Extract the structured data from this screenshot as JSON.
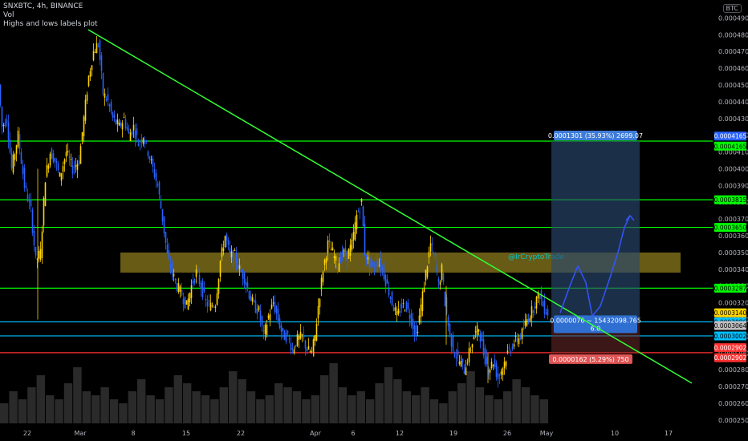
{
  "header": {
    "symbol_line": "SNXBTC, 4h, BINANCE",
    "indicator_1": "Vol",
    "indicator_2": "Highs and lows labels plot",
    "currency": "BTC"
  },
  "chart_data": {
    "type": "candlestick",
    "x_ticks": [
      "22",
      "Mar",
      "8",
      "15",
      "22",
      "Apr",
      "6",
      "12",
      "19",
      "26",
      "May",
      "10",
      "17"
    ],
    "y_ticks": [
      "0.0004900",
      "0.0004800",
      "0.0004700",
      "0.0004600",
      "0.0004500",
      "0.0004400",
      "0.0004300",
      "0.0004200",
      "0.0004100",
      "0.0004000",
      "0.0003900",
      "0.0003800",
      "0.0003700",
      "0.0003600",
      "0.0003500",
      "0.0003400",
      "0.0003300",
      "0.0003200",
      "0.0003100",
      "0.0003000",
      "0.0002900",
      "0.0002800",
      "0.0002700",
      "0.0002600",
      "0.0002500"
    ],
    "ylim": [
      0.000248,
      0.000495
    ],
    "price_path": [
      [
        0,
        0.00045
      ],
      [
        4,
        0.000425
      ],
      [
        10,
        0.00043
      ],
      [
        16,
        0.0004
      ],
      [
        24,
        0.00042
      ],
      [
        32,
        0.00039
      ],
      [
        40,
        0.000375
      ],
      [
        46,
        0.000345
      ],
      [
        52,
        0.00035
      ],
      [
        58,
        0.000395
      ],
      [
        64,
        0.00041
      ],
      [
        70,
        0.000405
      ],
      [
        76,
        0.000395
      ],
      [
        84,
        0.00041
      ],
      [
        92,
        0.0004
      ],
      [
        100,
        0.000405
      ],
      [
        106,
        0.00043
      ],
      [
        112,
        0.000455
      ],
      [
        118,
        0.00047
      ],
      [
        124,
        0.000475
      ],
      [
        130,
        0.000445
      ],
      [
        136,
        0.00044
      ],
      [
        142,
        0.00043
      ],
      [
        150,
        0.000425
      ],
      [
        156,
        0.00043
      ],
      [
        162,
        0.00042
      ],
      [
        168,
        0.000425
      ],
      [
        174,
        0.000415
      ],
      [
        180,
        0.00042
      ],
      [
        186,
        0.00041
      ],
      [
        192,
        0.0004
      ],
      [
        198,
        0.00039
      ],
      [
        204,
        0.00037
      ],
      [
        210,
        0.000348
      ],
      [
        216,
        0.000338
      ],
      [
        222,
        0.00033
      ],
      [
        228,
        0.000325
      ],
      [
        234,
        0.000318
      ],
      [
        240,
        0.00033
      ],
      [
        246,
        0.000338
      ],
      [
        252,
        0.00033
      ],
      [
        258,
        0.00032
      ],
      [
        264,
        0.000318
      ],
      [
        270,
        0.00032
      ],
      [
        276,
        0.000345
      ],
      [
        282,
        0.00036
      ],
      [
        288,
        0.000348
      ],
      [
        294,
        0.000348
      ],
      [
        300,
        0.00034
      ],
      [
        306,
        0.000335
      ],
      [
        312,
        0.000325
      ],
      [
        318,
        0.000318
      ],
      [
        324,
        0.000315
      ],
      [
        330,
        0.0003
      ],
      [
        336,
        0.000312
      ],
      [
        342,
        0.00032
      ],
      [
        348,
        0.00031
      ],
      [
        354,
        0.0003
      ],
      [
        360,
        0.0003
      ],
      [
        366,
        0.000292
      ],
      [
        372,
        0.000298
      ],
      [
        378,
        0.0003
      ],
      [
        384,
        0.000292
      ],
      [
        390,
        0.00029
      ],
      [
        394,
        0.0003
      ],
      [
        398,
        0.000318
      ],
      [
        404,
        0.00034
      ],
      [
        410,
        0.000355
      ],
      [
        416,
        0.00035
      ],
      [
        422,
        0.000342
      ],
      [
        428,
        0.00035
      ],
      [
        434,
        0.000348
      ],
      [
        440,
        0.000355
      ],
      [
        446,
        0.000372
      ],
      [
        452,
        0.00038
      ],
      [
        456,
        0.00035
      ],
      [
        460,
        0.000345
      ],
      [
        466,
        0.00034
      ],
      [
        472,
        0.000345
      ],
      [
        478,
        0.00034
      ],
      [
        484,
        0.00033
      ],
      [
        490,
        0.00032
      ],
      [
        496,
        0.000312
      ],
      [
        502,
        0.000318
      ],
      [
        508,
        0.000318
      ],
      [
        514,
        0.00031
      ],
      [
        520,
        0.0003
      ],
      [
        526,
        0.000318
      ],
      [
        532,
        0.000338
      ],
      [
        538,
        0.000355
      ],
      [
        544,
        0.000345
      ],
      [
        548,
        0.00033
      ],
      [
        552,
        0.00034
      ],
      [
        556,
        0.00032
      ],
      [
        562,
        0.0003
      ],
      [
        568,
        0.00029
      ],
      [
        574,
        0.000285
      ],
      [
        580,
        0.00028
      ],
      [
        586,
        0.00029
      ],
      [
        592,
        0.0003
      ],
      [
        598,
        0.000305
      ],
      [
        604,
        0.00029
      ],
      [
        610,
        0.00028
      ],
      [
        616,
        0.000285
      ],
      [
        622,
        0.000275
      ],
      [
        628,
        0.000282
      ],
      [
        634,
        0.00029
      ],
      [
        640,
        0.000295
      ],
      [
        646,
        0.000298
      ],
      [
        652,
        0.000302
      ],
      [
        658,
        0.00031
      ],
      [
        664,
        0.000315
      ],
      [
        670,
        0.000322
      ],
      [
        674,
        0.000325
      ],
      [
        678,
        0.000318
      ],
      [
        684,
        0.000314
      ]
    ],
    "volume_bars": [
      5,
      8,
      6,
      9,
      12,
      7,
      6,
      10,
      14,
      8,
      7,
      9,
      6,
      5,
      8,
      11,
      7,
      6,
      9,
      12,
      10,
      8,
      7,
      6,
      9,
      13,
      11,
      8,
      6,
      7,
      10,
      9,
      8,
      6,
      7,
      12,
      15,
      9,
      7,
      8,
      6,
      10,
      14,
      11,
      8,
      7,
      9,
      6,
      5,
      8,
      10,
      13,
      9,
      7,
      6,
      8,
      11,
      9,
      7,
      6
    ],
    "horizontal_levels": [
      {
        "price": 0.0004165,
        "color": "#00ff00"
      },
      {
        "price": 0.0003815,
        "color": "#00ff00"
      },
      {
        "price": 0.000365,
        "color": "#00ff00"
      },
      {
        "price": 0.0003287,
        "color": "#00ff00"
      },
      {
        "price": 0.0003086,
        "color": "#00bfff"
      },
      {
        "price": 0.0003002,
        "color": "#00bfff"
      },
      {
        "price": 0.0002902,
        "color": "#ff3030"
      }
    ],
    "trendline": {
      "start": [
        110,
        0.000483
      ],
      "end": [
        862,
        0.000272
      ],
      "color": "#33ff33"
    },
    "resistance_zone": {
      "top": 0.00035,
      "bottom": 0.000338,
      "x0": 150,
      "x1": 848,
      "color": "#8b7a1e"
    },
    "watermark": "@IrCryptoTrade",
    "position_tool": {
      "x0": 687,
      "x1": 797,
      "target": 0.0004165,
      "entry": 0.0003086,
      "stop": 0.0002902,
      "target_label": "0.0001301 (35.93%) 2699.07",
      "entry_label_1": "0.0000076 ~ 15432098.765",
      "entry_label_2": "6.0",
      "stop_label": "0.0000162 (5.29%) 750"
    },
    "projection_path": [
      [
        698,
        0.000314
      ],
      [
        710,
        0.00033
      ],
      [
        720,
        0.000342
      ],
      [
        730,
        0.000332
      ],
      [
        738,
        0.000312
      ],
      [
        748,
        0.000318
      ],
      [
        760,
        0.000335
      ],
      [
        770,
        0.00035
      ],
      [
        778,
        0.000365
      ],
      [
        785,
        0.000372
      ]
    ],
    "projection_color": "#3355ff",
    "price_axis_labels": [
      {
        "text": "0.0004165",
        "price": 0.0004195,
        "bg": "#2962ff",
        "fg": "#ffffff"
      },
      {
        "text": "0.0004165",
        "price": 0.0004135,
        "bg": "#00ff00",
        "fg": "#000000"
      },
      {
        "text": "0.0003815",
        "price": 0.0003815,
        "bg": "#00ff00",
        "fg": "#000000"
      },
      {
        "text": "0.0003650",
        "price": 0.000365,
        "bg": "#00ff00",
        "fg": "#000000"
      },
      {
        "text": "0.0003287",
        "price": 0.0003287,
        "bg": "#00ff00",
        "fg": "#000000"
      },
      {
        "text": "0.0003140",
        "price": 0.000314,
        "bg": "#ffd400",
        "fg": "#000000"
      },
      {
        "text": "0.0003086",
        "price": 0.0003086,
        "bg": "#00bfff",
        "fg": "#000000"
      },
      {
        "text": "0.0003064",
        "price": 0.0003064,
        "bg": "#bfbfbf",
        "fg": "#000000"
      },
      {
        "text": "0.0003002",
        "price": 0.0003002,
        "bg": "#00bfff",
        "fg": "#000000"
      },
      {
        "text": "0.0002902",
        "price": 0.0002932,
        "bg": "#ff3030",
        "fg": "#ffffff"
      },
      {
        "text": "0.0002902",
        "price": 0.0002872,
        "bg": "#ff3030",
        "fg": "#ffffff"
      }
    ],
    "colors": {
      "candle_up": "#ffd400",
      "candle_down": "#2962ff",
      "axis_text": "#b2b5be",
      "volume": "#2a2a2a"
    }
  }
}
